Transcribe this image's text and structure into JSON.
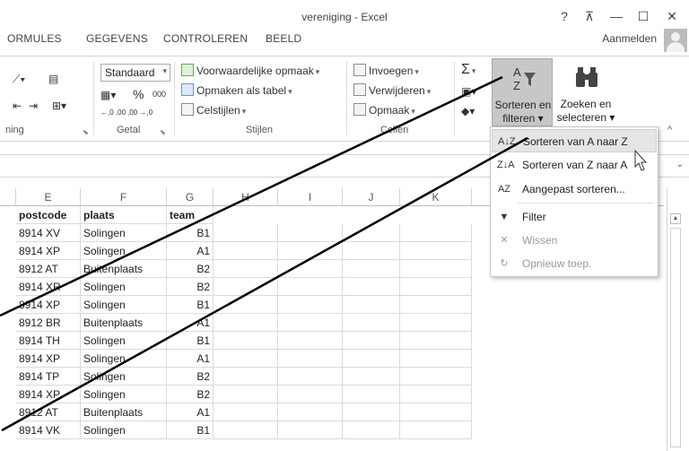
{
  "window": {
    "title": "vereniging - Excel",
    "help": "?",
    "restore_ribbon": "⊼",
    "minimize": "—",
    "maximize": "☐",
    "close": "✕"
  },
  "tabs": [
    "ORMULES",
    "GEGEVENS",
    "CONTROLEREN",
    "BEELD"
  ],
  "signin": "Aanmelden",
  "ribbon": {
    "number_format": "Standaard",
    "percent": "%",
    "thousands": "000",
    "dec_inc": "←,0 ,00",
    "dec_dec": ",00 →,0",
    "conditional": "Voorwaardelijke opmaak",
    "as_table": "Opmaken als tabel",
    "cell_styles": "Celstijlen",
    "insert": "Invoegen",
    "delete": "Verwijderen",
    "format": "Opmaak",
    "sum_symbol": "Σ",
    "sort_filter_line1": "Sorteren en",
    "sort_filter_line2": "filteren",
    "find_line1": "Zoeken en",
    "find_line2": "selecteren",
    "groups": {
      "alignment": "ning",
      "number": "Getal",
      "styles": "Stijlen",
      "cells": "Cellen"
    }
  },
  "columns": [
    "E",
    "F",
    "G",
    "H",
    "I",
    "J",
    "K"
  ],
  "table": {
    "headers": [
      "postcode",
      "plaats",
      "team"
    ],
    "rows": [
      [
        "8914 XV",
        "Solingen",
        "B1"
      ],
      [
        "8914 XP",
        "Solingen",
        "A1"
      ],
      [
        "8912 AT",
        "Buitenplaats",
        "B2"
      ],
      [
        "8914 XR",
        "Solingen",
        "B2"
      ],
      [
        "8914 XP",
        "Solingen",
        "B1"
      ],
      [
        "8912 BR",
        "Buitenplaats",
        "A1"
      ],
      [
        "8914 TH",
        "Solingen",
        "B1"
      ],
      [
        "8914 XP",
        "Solingen",
        "A1"
      ],
      [
        "8914 TP",
        "Solingen",
        "B2"
      ],
      [
        "8914 XP",
        "Solingen",
        "B2"
      ],
      [
        "8912 AT",
        "Buitenplaats",
        "A1"
      ],
      [
        "8914 VK",
        "Solingen",
        "B1"
      ]
    ]
  },
  "menu": {
    "items": [
      {
        "icon": "A↓Z",
        "label": "Sorteren van A naar Z",
        "disabled": false,
        "hover": true
      },
      {
        "icon": "Z↓A",
        "label": "Sorteren van Z naar A",
        "disabled": false,
        "hover": false
      },
      {
        "icon": "AZ",
        "label": "Aangepast sorteren...",
        "disabled": false,
        "hover": false
      },
      {
        "icon": "▼",
        "label": "Filter",
        "disabled": false,
        "hover": false
      },
      {
        "icon": "✕",
        "label": "Wissen",
        "disabled": true,
        "hover": false
      },
      {
        "icon": "↻",
        "label": "Opnieuw toep.",
        "disabled": true,
        "hover": false
      }
    ]
  },
  "colors": {
    "sort_button_bg": "#c7c7c7",
    "menu_hover": "#e5e5e5",
    "callout_line": "#000000"
  }
}
